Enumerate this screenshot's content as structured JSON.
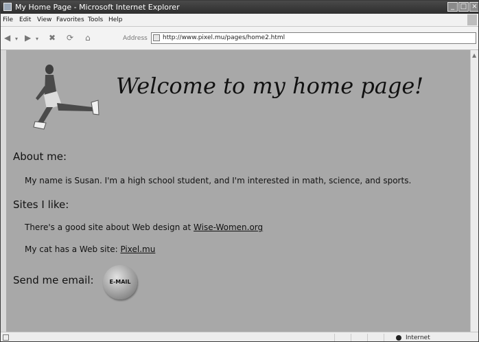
{
  "window": {
    "title": "My Home Page - Microsoft Internet Explorer"
  },
  "menu": {
    "items": [
      "File",
      "Edit",
      "View",
      "Favorites",
      "Tools",
      "Help"
    ]
  },
  "toolbar": {
    "address_label": "Address",
    "url": "http://www.pixel.mu/pages/home2.html"
  },
  "page": {
    "heading": "Welcome to my home page!",
    "about_title": "About me:",
    "about_text": "My name is Susan. I'm a high school student, and I'm interested in math, science, and sports.",
    "sites_title": "Sites I like:",
    "site1_text": "There's a good site about Web design at ",
    "site1_link": "Wise-Women.org",
    "site2_text": "My cat has a Web site: ",
    "site2_link": "Pixel.mu",
    "email_title": "Send me email:",
    "email_button": "E-MAIL"
  },
  "status": {
    "zone": "Internet"
  }
}
